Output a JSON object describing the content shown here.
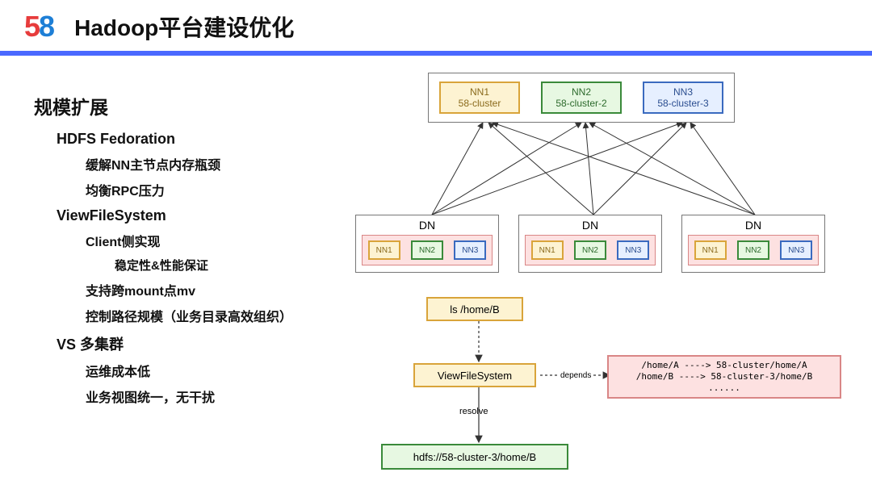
{
  "header": {
    "logo5": "5",
    "logo8": "8",
    "title": "Hadoop平台建设优化"
  },
  "outline": {
    "h1": "规模扩展",
    "items": [
      {
        "level": "h2",
        "text": "HDFS Fedoration"
      },
      {
        "level": "h3",
        "text": "缓解NN主节点内存瓶颈"
      },
      {
        "level": "h3",
        "text": "均衡RPC压力"
      },
      {
        "level": "h2",
        "text": "ViewFileSystem"
      },
      {
        "level": "h3",
        "text": "Client侧实现"
      },
      {
        "level": "h4",
        "text": "稳定性&性能保证"
      },
      {
        "level": "h3",
        "text": "支持跨mount点mv"
      },
      {
        "level": "h3",
        "text": "控制路径规模（业务目录高效组织）"
      },
      {
        "level": "h2",
        "text": "VS 多集群"
      },
      {
        "level": "h3",
        "text": "运维成本低"
      },
      {
        "level": "h3",
        "text": "业务视图统一，无干扰"
      }
    ]
  },
  "diagram": {
    "nn": [
      {
        "code": "NN1",
        "cluster": "58-cluster",
        "cls": "nn1"
      },
      {
        "code": "NN2",
        "cluster": "58-cluster-2",
        "cls": "nn2"
      },
      {
        "code": "NN3",
        "cluster": "58-cluster-3",
        "cls": "nn3"
      }
    ],
    "dn_title": "DN",
    "mini": [
      {
        "text": "NN1",
        "cls": "nn1"
      },
      {
        "text": "NN2",
        "cls": "nn2"
      },
      {
        "text": "NN3",
        "cls": "nn3"
      }
    ],
    "cmd": "ls /home/B",
    "vfs": "ViewFileSystem",
    "resolve_label": "resolve",
    "depends_label": "depends",
    "resolved": "hdfs://58-cluster-3/home/B",
    "map1": "/home/A  ---->  58-cluster/home/A",
    "map2": "/home/B  ---->  58-cluster-3/home/B",
    "map3": "......"
  }
}
